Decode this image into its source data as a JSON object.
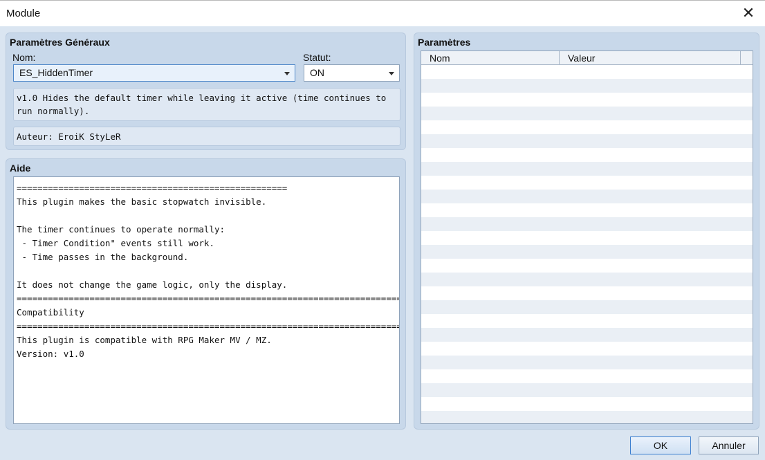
{
  "window": {
    "title": "Module",
    "close_glyph": "✕"
  },
  "general": {
    "title": "Paramètres Généraux",
    "name_label": "Nom:",
    "name_value": "ES_HiddenTimer",
    "status_label": "Statut:",
    "status_value": "ON",
    "description": "v1.0 Hides the default timer while leaving it active (time continues to run normally).",
    "author": "Auteur: EroiK StyLeR"
  },
  "help": {
    "title": "Aide",
    "text": "====================================================\nThis plugin makes the basic stopwatch invisible.\n\nThe timer continues to operate normally:\n - Timer Condition\" events still work.\n - Time passes in the background.\n\nIt does not change the game logic, only the display.\n===========================================================================\nCompatibility\n===========================================================================\nThis plugin is compatible with RPG Maker MV / MZ.\nVersion: v1.0"
  },
  "params": {
    "title": "Paramètres",
    "columns": [
      "Nom",
      "Valeur"
    ],
    "rows": []
  },
  "buttons": {
    "ok": "OK",
    "cancel": "Annuler"
  }
}
